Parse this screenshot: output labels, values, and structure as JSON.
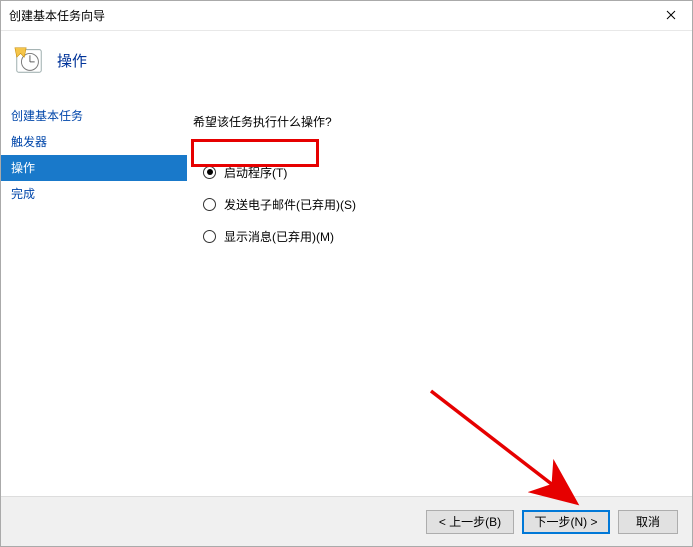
{
  "window": {
    "title": "创建基本任务向导"
  },
  "header": {
    "title": "操作"
  },
  "sidebar": {
    "items": [
      {
        "label": "创建基本任务"
      },
      {
        "label": "触发器"
      },
      {
        "label": "操作"
      },
      {
        "label": "完成"
      }
    ]
  },
  "content": {
    "prompt": "希望该任务执行什么操作?",
    "options": [
      {
        "label": "启动程序(T)"
      },
      {
        "label": "发送电子邮件(已弃用)(S)"
      },
      {
        "label": "显示消息(已弃用)(M)"
      }
    ]
  },
  "footer": {
    "back": "< 上一步(B)",
    "next": "下一步(N) >",
    "cancel": "取消"
  }
}
